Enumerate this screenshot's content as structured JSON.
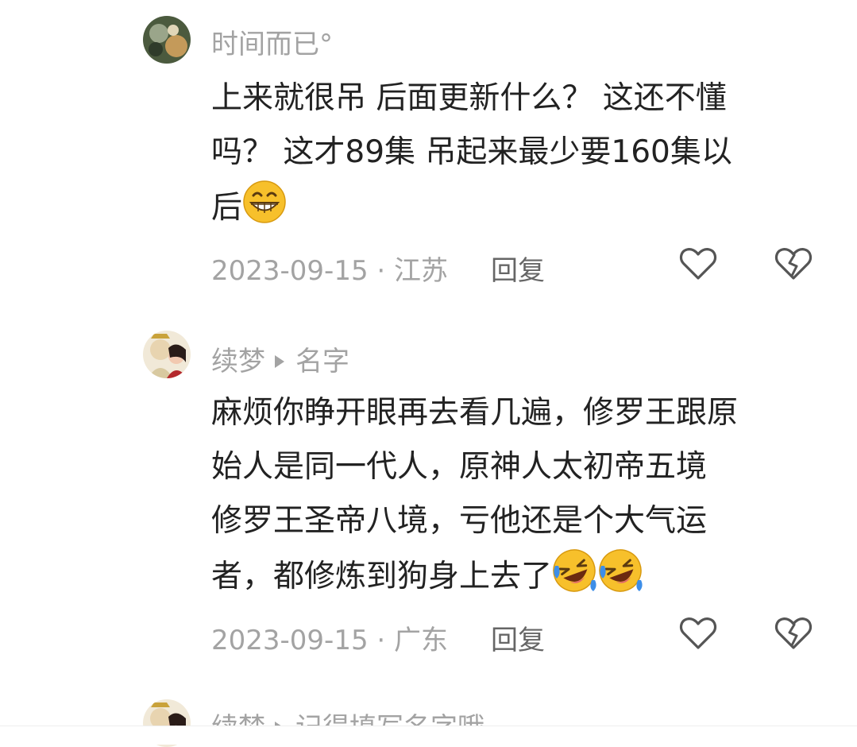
{
  "comments": [
    {
      "username": "时间而已°",
      "lines": [
        "上来就很吊  后面更新什么？   这还不懂",
        "吗？  这才89集   吊起来最少要160集以",
        "后"
      ],
      "date": "2023-09-15",
      "separator": "·",
      "location": "江苏",
      "reply_label": "回复",
      "emoji": "grin-emoji"
    },
    {
      "username": "续梦",
      "reply_to": "名字",
      "lines": [
        "麻烦你睁开眼再去看几遍，修罗王跟原",
        "始人是同一代人，原神人太初帝五境",
        "修罗王圣帝八境，亏他还是个大气运",
        "者，都修炼到狗身上去了"
      ],
      "date": "2023-09-15",
      "separator": "·",
      "location": "广东",
      "reply_label": "回复",
      "emoji": "rofl-emoji"
    },
    {
      "username": "续梦",
      "reply_to": "记得填写名字哦"
    }
  ],
  "colors": {
    "secondary": "#a3a3a3",
    "text": "#222222",
    "emoji": "#f7c02b"
  }
}
